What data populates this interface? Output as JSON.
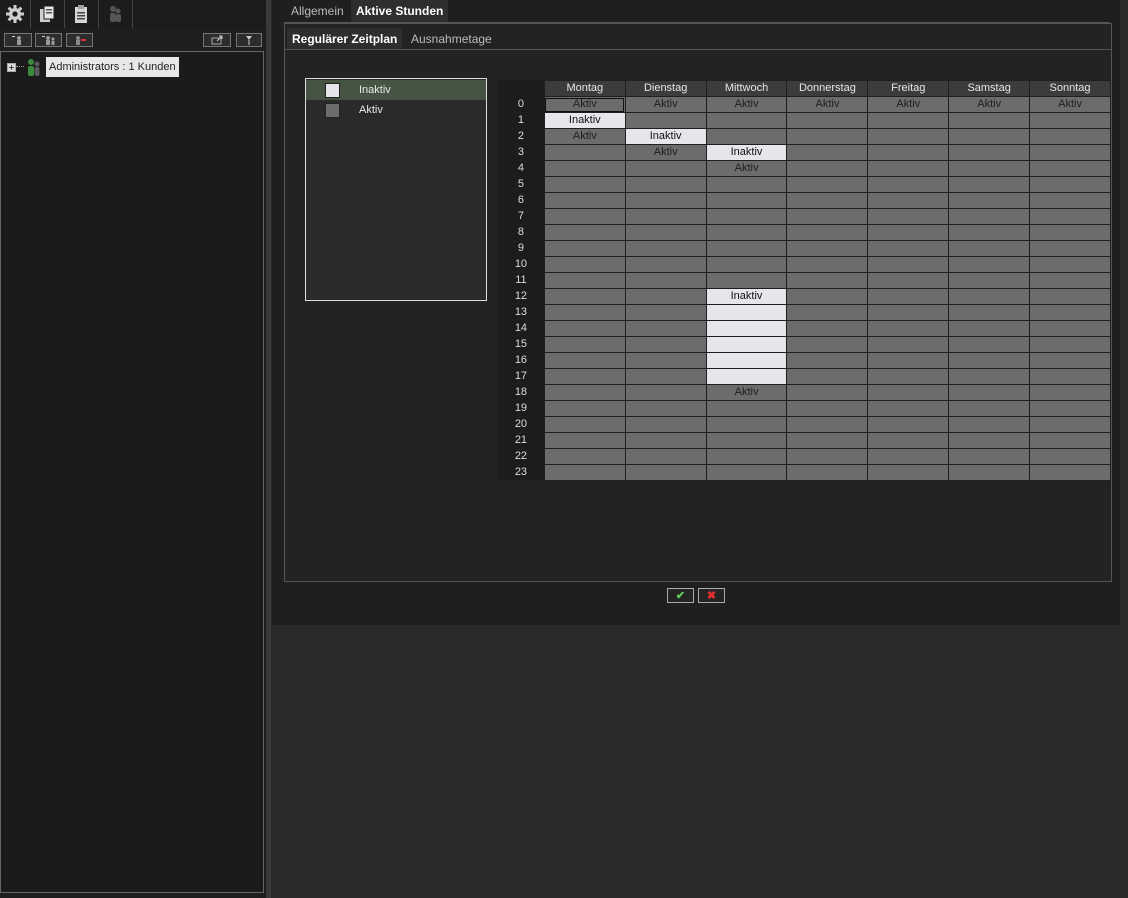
{
  "sidebar": {
    "toolbar_icons": [
      "gear-icon",
      "documents-icon",
      "clipboard-icon",
      "users-icon"
    ],
    "small_buttons": [
      "add-user-icon",
      "add-group-icon",
      "remove-user-icon",
      "export-icon",
      "filter-icon"
    ],
    "tree": {
      "label": "Administrators : 1 Kunden",
      "expander": "+"
    }
  },
  "tabs": {
    "allgemein": "Allgemein",
    "aktive_stunden": "Aktive Stunden"
  },
  "subtabs": {
    "regular": "Regulärer Zeitplan",
    "ausnahmetage": "Ausnahmetage"
  },
  "legend": {
    "inaktiv": "Inaktiv",
    "aktiv": "Aktiv"
  },
  "colors": {
    "inaktiv": "#e6e6ea",
    "aktiv": "#6c6c6c",
    "selected_row": "#465543",
    "ok": "#5fd35f",
    "cancel": "#e03030"
  },
  "schedule": {
    "days": [
      "Montag",
      "Dienstag",
      "Mittwoch",
      "Donnerstag",
      "Freitag",
      "Samstag",
      "Sonntag"
    ],
    "hours": [
      "0",
      "1",
      "2",
      "3",
      "4",
      "5",
      "6",
      "7",
      "8",
      "9",
      "10",
      "11",
      "12",
      "13",
      "14",
      "15",
      "16",
      "17",
      "18",
      "19",
      "20",
      "21",
      "22",
      "23"
    ],
    "inactive": [
      [
        false,
        false,
        false,
        false,
        false,
        false,
        false
      ],
      [
        true,
        false,
        false,
        false,
        false,
        false,
        false
      ],
      [
        false,
        true,
        false,
        false,
        false,
        false,
        false
      ],
      [
        false,
        false,
        true,
        false,
        false,
        false,
        false
      ],
      [
        false,
        false,
        false,
        false,
        false,
        false,
        false
      ],
      [
        false,
        false,
        false,
        false,
        false,
        false,
        false
      ],
      [
        false,
        false,
        false,
        false,
        false,
        false,
        false
      ],
      [
        false,
        false,
        false,
        false,
        false,
        false,
        false
      ],
      [
        false,
        false,
        false,
        false,
        false,
        false,
        false
      ],
      [
        false,
        false,
        false,
        false,
        false,
        false,
        false
      ],
      [
        false,
        false,
        false,
        false,
        false,
        false,
        false
      ],
      [
        false,
        false,
        false,
        false,
        false,
        false,
        false
      ],
      [
        false,
        false,
        true,
        false,
        false,
        false,
        false
      ],
      [
        false,
        false,
        true,
        false,
        false,
        false,
        false
      ],
      [
        false,
        false,
        true,
        false,
        false,
        false,
        false
      ],
      [
        false,
        false,
        true,
        false,
        false,
        false,
        false
      ],
      [
        false,
        false,
        true,
        false,
        false,
        false,
        false
      ],
      [
        false,
        false,
        true,
        false,
        false,
        false,
        false
      ],
      [
        false,
        false,
        false,
        false,
        false,
        false,
        false
      ],
      [
        false,
        false,
        false,
        false,
        false,
        false,
        false
      ],
      [
        false,
        false,
        false,
        false,
        false,
        false,
        false
      ],
      [
        false,
        false,
        false,
        false,
        false,
        false,
        false
      ],
      [
        false,
        false,
        false,
        false,
        false,
        false,
        false
      ],
      [
        false,
        false,
        false,
        false,
        false,
        false,
        false
      ]
    ],
    "labels": [
      [
        0,
        0,
        "Aktiv"
      ],
      [
        0,
        1,
        "Aktiv"
      ],
      [
        0,
        2,
        "Aktiv"
      ],
      [
        0,
        3,
        "Aktiv"
      ],
      [
        0,
        4,
        "Aktiv"
      ],
      [
        0,
        5,
        "Aktiv"
      ],
      [
        0,
        6,
        "Aktiv"
      ],
      [
        1,
        0,
        "Inaktiv"
      ],
      [
        2,
        0,
        "Aktiv"
      ],
      [
        2,
        1,
        "Inaktiv"
      ],
      [
        3,
        1,
        "Aktiv"
      ],
      [
        3,
        2,
        "Inaktiv"
      ],
      [
        4,
        2,
        "Aktiv"
      ],
      [
        12,
        2,
        "Inaktiv"
      ],
      [
        18,
        2,
        "Aktiv"
      ]
    ]
  },
  "buttons": {
    "ok": "✔",
    "cancel": "✖"
  }
}
